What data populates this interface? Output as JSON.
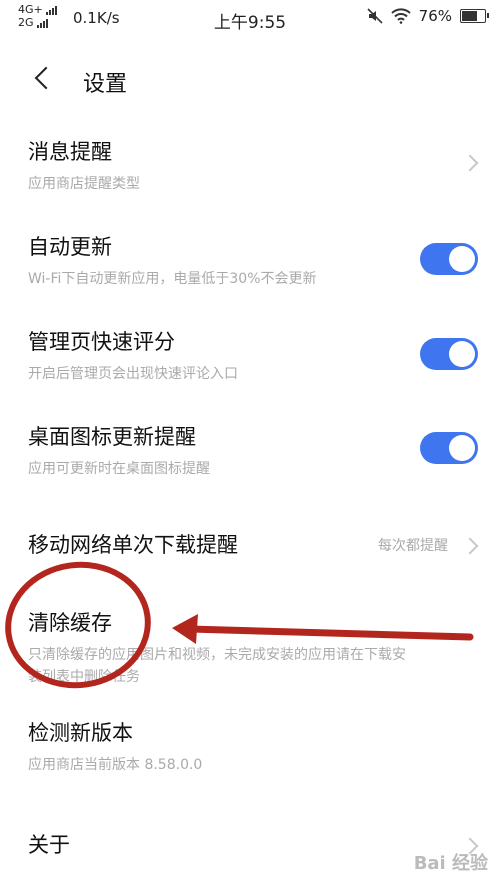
{
  "statusbar": {
    "network_top": "4G+",
    "network_bottom": "2G",
    "speed": "0.1K/s",
    "time": "上午9:55",
    "battery": "76%",
    "battery_level": 0.76
  },
  "header": {
    "title": "设置"
  },
  "items": [
    {
      "title": "消息提醒",
      "subtitle": "应用商店提醒类型"
    },
    {
      "title": "自动更新",
      "subtitle": "Wi-Fi下自动更新应用，电量低于30%不会更新",
      "toggle": true
    },
    {
      "title": "管理页快速评分",
      "subtitle": "开启后管理页会出现快速评论入口",
      "toggle": true
    },
    {
      "title": "桌面图标更新提醒",
      "subtitle": "应用可更新时在桌面图标提醒",
      "toggle": true
    },
    {
      "title": "移动网络单次下载提醒",
      "value": "每次都提醒"
    },
    {
      "title": "清除缓存",
      "subtitle_line1": "只清除缓存的应用图片和视频，未完成安装的应用请在下载安",
      "subtitle_line2": "装列表中删除任务"
    },
    {
      "title": "检测新版本",
      "subtitle": "应用商店当前版本 8.58.0.0"
    },
    {
      "title": "关于"
    }
  ],
  "colors": {
    "accent": "#3f75ef",
    "annotation": "#b3261e"
  },
  "watermark": {
    "text": "Bai 经验"
  }
}
